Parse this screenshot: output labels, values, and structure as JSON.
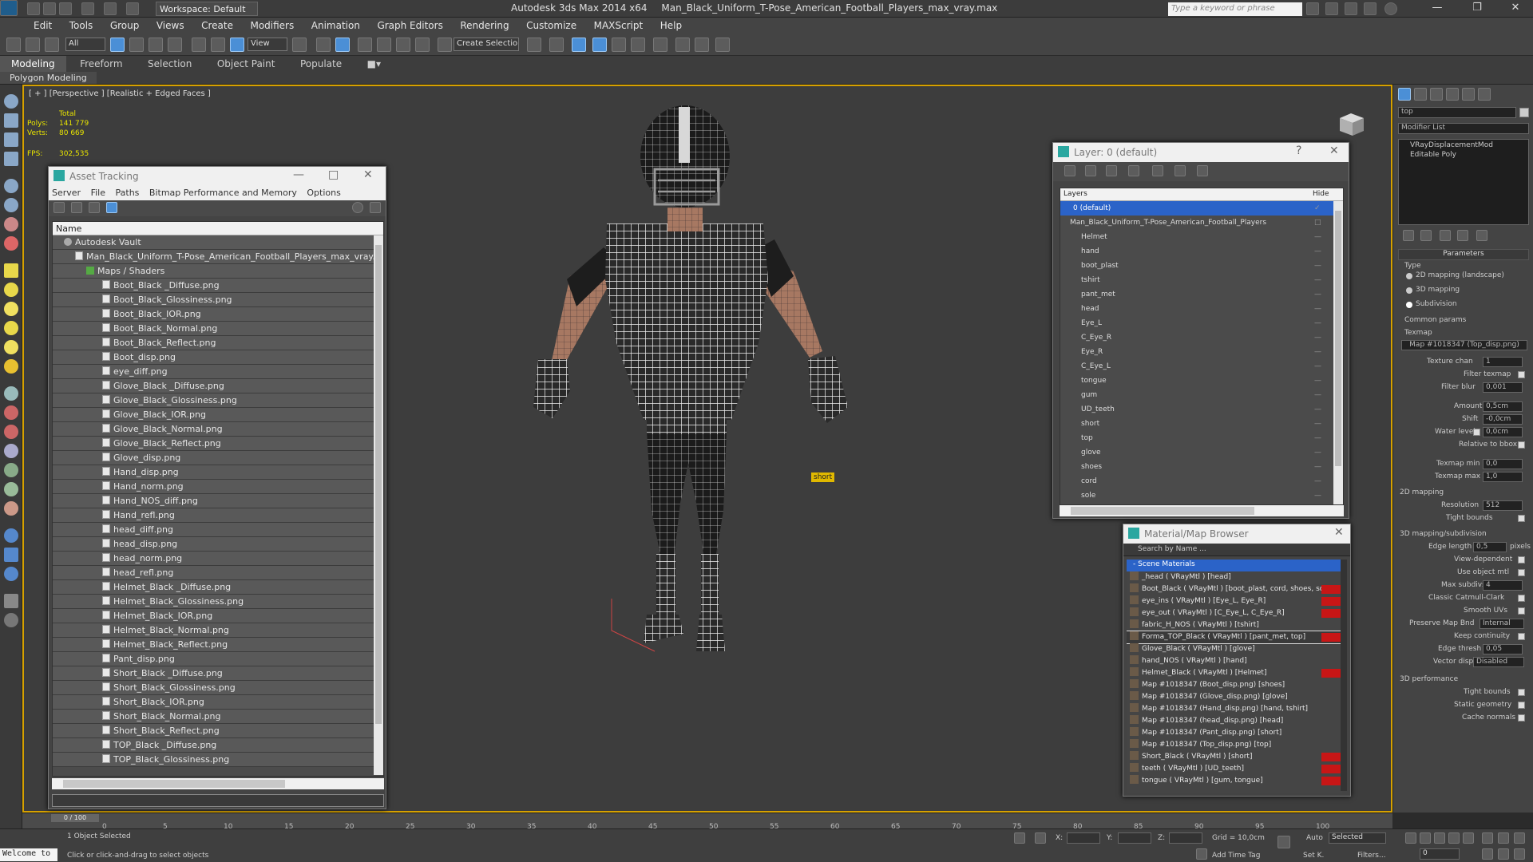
{
  "window": {
    "app_title": "Autodesk 3ds Max  2014 x64",
    "file_title": "Man_Black_Uniform_T-Pose_American_Football_Players_max_vray.max",
    "workspace": "Workspace: Default",
    "search_placeholder": "Type a keyword or phrase"
  },
  "menu": [
    "Edit",
    "Tools",
    "Group",
    "Views",
    "Create",
    "Modifiers",
    "Animation",
    "Graph Editors",
    "Rendering",
    "Customize",
    "MAXScript",
    "Help"
  ],
  "toolbar": {
    "selection_filter": "All",
    "coord_system": "View",
    "named_selection": "Create Selection Se"
  },
  "ribbon": {
    "tabs": [
      "Modeling",
      "Freeform",
      "Selection",
      "Object Paint",
      "Populate"
    ],
    "active_tab": "Modeling",
    "subtab": "Polygon Modeling"
  },
  "viewport": {
    "label": "[ + ] [Perspective ] [Realistic + Edged Faces ]",
    "stats": {
      "total_label": "Total",
      "polys_label": "Polys:",
      "polys_value": "141 779",
      "verts_label": "Verts:",
      "verts_value": "80 669",
      "fps_label": "FPS:",
      "fps_value": "302,535"
    },
    "object_label": "short"
  },
  "asset_tracking": {
    "title": "Asset Tracking",
    "menu": [
      "Server",
      "File",
      "Paths",
      "Bitmap Performance and Memory",
      "Options"
    ],
    "column": "Name",
    "vault": "Autodesk Vault",
    "file": "Man_Black_Uniform_T-Pose_American_Football_Players_max_vray.max",
    "group": "Maps / Shaders",
    "maps": [
      "Boot_Black _Diffuse.png",
      "Boot_Black_Glossiness.png",
      "Boot_Black_IOR.png",
      "Boot_Black_Normal.png",
      "Boot_Black_Reflect.png",
      "Boot_disp.png",
      "eye_diff.png",
      "Glove_Black _Diffuse.png",
      "Glove_Black_Glossiness.png",
      "Glove_Black_IOR.png",
      "Glove_Black_Normal.png",
      "Glove_Black_Reflect.png",
      "Glove_disp.png",
      "Hand_disp.png",
      "Hand_norm.png",
      "Hand_NOS_diff.png",
      "Hand_refl.png",
      "head_diff.png",
      "head_disp.png",
      "head_norm.png",
      "head_refl.png",
      "Helmet_Black _Diffuse.png",
      "Helmet_Black_Glossiness.png",
      "Helmet_Black_IOR.png",
      "Helmet_Black_Normal.png",
      "Helmet_Black_Reflect.png",
      "Pant_disp.png",
      "Short_Black _Diffuse.png",
      "Short_Black_Glossiness.png",
      "Short_Black_IOR.png",
      "Short_Black_Normal.png",
      "Short_Black_Reflect.png",
      "TOP_Black _Diffuse.png",
      "TOP_Black_Glossiness.png"
    ]
  },
  "layer_dialog": {
    "title": "Layer: 0 (default)",
    "col_layers": "Layers",
    "col_hide": "Hide",
    "default_layer": "0 (default)",
    "parent_layer": "Man_Black_Uniform_T-Pose_American_Football_Players",
    "children": [
      "Helmet",
      "hand",
      "boot_plast",
      "tshirt",
      "pant_met",
      "head",
      "Eye_L",
      "C_Eye_R",
      "Eye_R",
      "C_Eye_L",
      "tongue",
      "gum",
      "UD_teeth",
      "short",
      "top",
      "glove",
      "shoes",
      "cord",
      "sole"
    ]
  },
  "material_browser": {
    "title": "Material/Map Browser",
    "search": "Search by Name ...",
    "section": "- Scene Materials",
    "materials": [
      {
        "label": "_head  ( VRayMtl ) [head]",
        "red": false
      },
      {
        "label": "Boot_Black ( VRayMtl ) [boot_plast, cord, shoes, sole]",
        "red": true
      },
      {
        "label": "eye_ins  ( VRayMtl ) [Eye_L, Eye_R]",
        "red": true
      },
      {
        "label": "eye_out  ( VRayMtl ) [C_Eye_L, C_Eye_R]",
        "red": true
      },
      {
        "label": "fabric_H_NOS  ( VRayMtl ) [tshirt]",
        "red": false
      },
      {
        "label": "Forma_TOP_Black  ( VRayMtl ) [pant_met, top]",
        "red": true
      },
      {
        "label": "Glove_Black  ( VRayMtl ) [glove]",
        "red": false
      },
      {
        "label": "hand_NOS  ( VRayMtl ) [hand]",
        "red": false
      },
      {
        "label": "Helmet_Black  ( VRayMtl ) [Helmet]",
        "red": true
      },
      {
        "label": "Map #1018347 (Boot_disp.png) [shoes]",
        "red": false
      },
      {
        "label": "Map #1018347 (Glove_disp.png) [glove]",
        "red": false
      },
      {
        "label": "Map #1018347 (Hand_disp.png) [hand, tshirt]",
        "red": false
      },
      {
        "label": "Map #1018347 (head_disp.png) [head]",
        "red": false
      },
      {
        "label": "Map #1018347 (Pant_disp.png) [short]",
        "red": false
      },
      {
        "label": "Map #1018347 (Top_disp.png) [top]",
        "red": false
      },
      {
        "label": "Short_Black  ( VRayMtl ) [short]",
        "red": true
      },
      {
        "label": "teeth  ( VRayMtl ) [UD_teeth]",
        "red": true
      },
      {
        "label": "tongue  ( VRayMtl ) [gum, tongue]",
        "red": true
      }
    ]
  },
  "command_panel": {
    "object_name": "top",
    "modifier_list": "Modifier List",
    "stack": [
      "VRayDisplacementMod",
      "Editable Poly"
    ],
    "parameters": "Parameters",
    "type_label": "Type",
    "types": [
      "2D mapping (landscape)",
      "3D mapping",
      "Subdivision"
    ],
    "common_params": "Common params",
    "texmap_label": "Texmap",
    "texmap_value": "Map #1018347 (Top_disp.png)",
    "texture_chan_label": "Texture chan",
    "texture_chan_value": "1",
    "filter_texmap": "Filter texmap",
    "filter_blur_label": "Filter blur",
    "filter_blur_value": "0,001",
    "amount_label": "Amount",
    "amount_value": "0,5cm",
    "shift_label": "Shift",
    "shift_value": "-0,0cm",
    "water_level_label": "Water level",
    "water_level_value": "0,0cm",
    "relative_bbox": "Relative to bbox",
    "texmap_min_label": "Texmap min",
    "texmap_min_value": "0,0",
    "texmap_max_label": "Texmap max",
    "texmap_max_value": "1,0",
    "mapping_2d": "2D mapping",
    "resolution_label": "Resolution",
    "resolution_value": "512",
    "tight_bounds": "Tight bounds",
    "mapping_3d": "3D mapping/subdivision",
    "edge_length_label": "Edge length",
    "edge_length_value": "0,5",
    "pixels": "pixels",
    "view_dependent": "View-dependent",
    "use_object_mtl": "Use object mtl",
    "max_subdivs_label": "Max subdivs",
    "max_subdivs_value": "4",
    "classic_catmull": "Classic Catmull-Clark",
    "smooth_uvs": "Smooth UVs",
    "preserve_map_bnd_label": "Preserve Map Bnd",
    "preserve_map_bnd_value": "Internal",
    "keep_continuity": "Keep continuity",
    "edge_thresh_label": "Edge thresh",
    "edge_thresh_value": "0,05",
    "vector_displ_label": "Vector displ",
    "vector_displ_value": "Disabled",
    "performance_3d": "3D performance",
    "perf_tight_bounds": "Tight bounds",
    "static_geometry": "Static geometry",
    "cache_normals": "Cache normals"
  },
  "timeline": {
    "frame_counter": "0 / 100",
    "ticks": [
      "0",
      "5",
      "10",
      "15",
      "20",
      "25",
      "30",
      "35",
      "40",
      "45",
      "50",
      "55",
      "60",
      "65",
      "70",
      "75",
      "80",
      "85",
      "90",
      "95",
      "100"
    ]
  },
  "status": {
    "welcome": "Welcome to",
    "selected": "1 Object Selected",
    "hint": "Click or click-and-drag to select objects",
    "x_label": "X:",
    "y_label": "Y:",
    "z_label": "Z:",
    "grid": "Grid = 10,0cm",
    "add_time_tag": "Add Time Tag",
    "auto": "Auto",
    "selected_dropdown": "Selected",
    "set_k": "Set K.",
    "filters": "Filters...",
    "frame": "0"
  },
  "colors": {
    "viewport_border": "#d6a100",
    "selection_blue": "#2b63c8",
    "stats_yellow": "#e8e400",
    "material_red": "#c81616"
  }
}
